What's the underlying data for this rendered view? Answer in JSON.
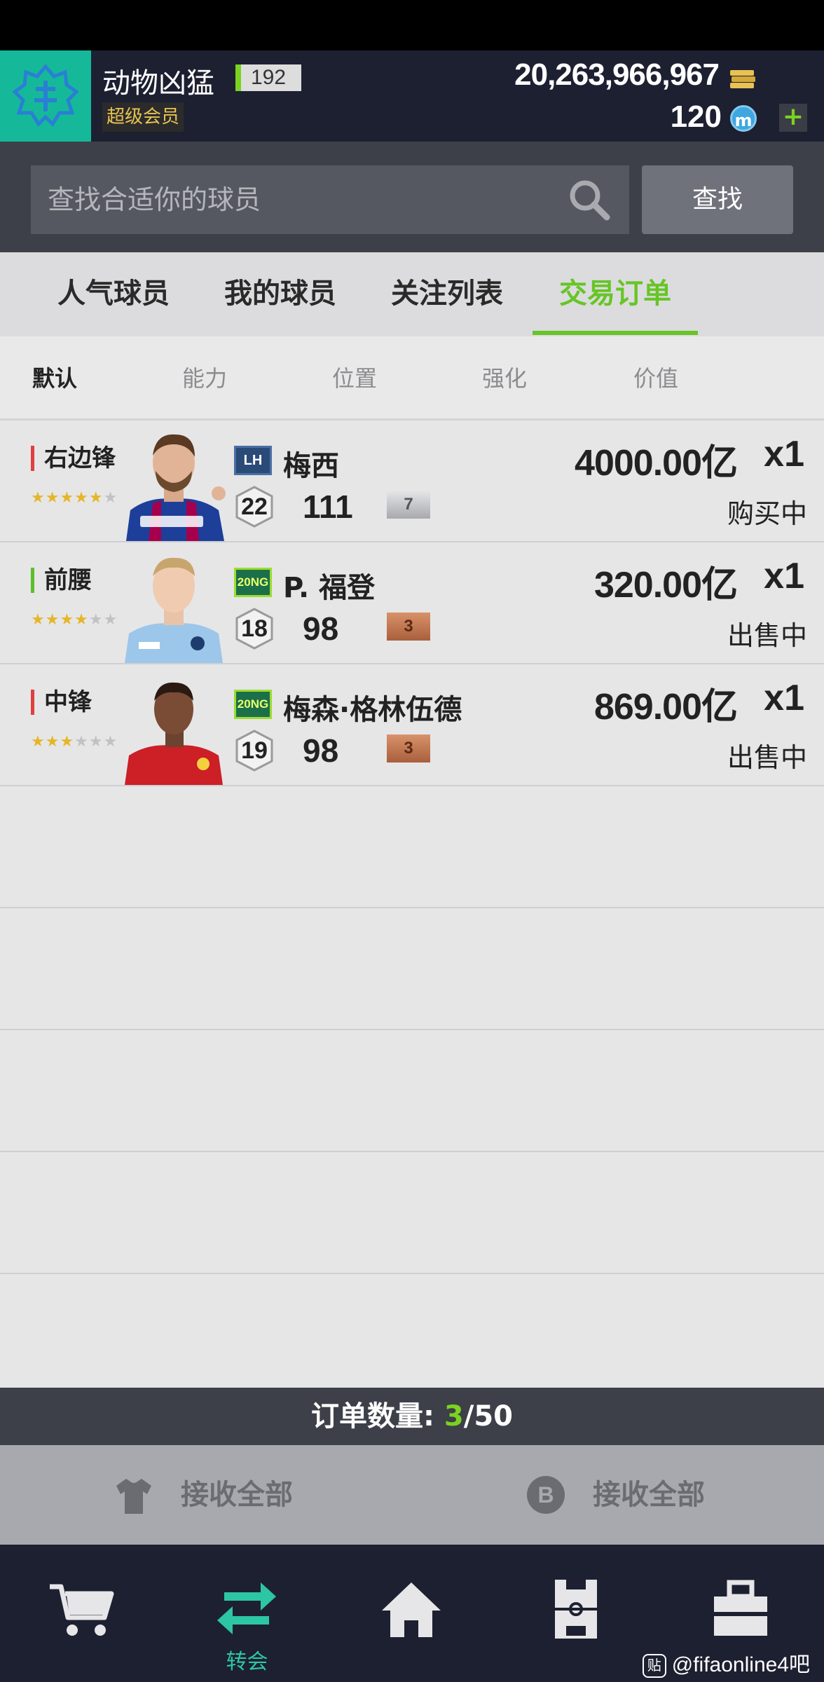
{
  "header": {
    "username": "动物凶猛",
    "level": "192",
    "vip_label": "超级会员",
    "coins": "20,263,966,967",
    "points": "120",
    "points_icon_letter": "m",
    "add_label": "+"
  },
  "search": {
    "placeholder": "查找合适你的球员",
    "button_label": "查找"
  },
  "tabs": [
    {
      "label": "人气球员",
      "active": false
    },
    {
      "label": "我的球员",
      "active": false
    },
    {
      "label": "关注列表",
      "active": false
    },
    {
      "label": "交易订单",
      "active": true
    }
  ],
  "sort_options": [
    {
      "label": "默认",
      "active": true
    },
    {
      "label": "能力",
      "active": false
    },
    {
      "label": "位置",
      "active": false
    },
    {
      "label": "强化",
      "active": false
    },
    {
      "label": "价值",
      "active": false
    }
  ],
  "orders": [
    {
      "position": "右边锋",
      "stars": 5,
      "season": "LH",
      "name": "梅西",
      "ovr": "22",
      "rating": "111",
      "upgrade": "7",
      "upgrade_tier": "silver",
      "price": "4000.00亿",
      "qty": "x1",
      "status": "购买中"
    },
    {
      "position": "前腰",
      "stars": 4,
      "season": "20NG",
      "name": "P. 福登",
      "ovr": "18",
      "rating": "98",
      "upgrade": "3",
      "upgrade_tier": "bronze",
      "price": "320.00亿",
      "qty": "x1",
      "status": "出售中"
    },
    {
      "position": "中锋",
      "stars": 3,
      "season": "20NG",
      "name": "梅森·格林伍德",
      "ovr": "19",
      "rating": "98",
      "upgrade": "3",
      "upgrade_tier": "bronze",
      "price": "869.00亿",
      "qty": "x1",
      "status": "出售中"
    }
  ],
  "order_count": {
    "label": "订单数量: ",
    "current": "3",
    "max": "/50"
  },
  "receive": {
    "left_label": "接收全部",
    "right_label": "接收全部",
    "right_icon_letter": "B"
  },
  "nav": {
    "items": [
      {
        "icon": "cart-icon",
        "label": ""
      },
      {
        "icon": "transfer-icon",
        "label": "转会"
      },
      {
        "icon": "home-icon",
        "label": ""
      },
      {
        "icon": "pitch-icon",
        "label": ""
      },
      {
        "icon": "bag-icon",
        "label": ""
      }
    ],
    "watermark": "@fifaonline4吧",
    "watermark_logo": "贴"
  },
  "colors": {
    "accent_green": "#67c526",
    "teal": "#2cc6a4",
    "dark_bg": "#1d2031"
  }
}
